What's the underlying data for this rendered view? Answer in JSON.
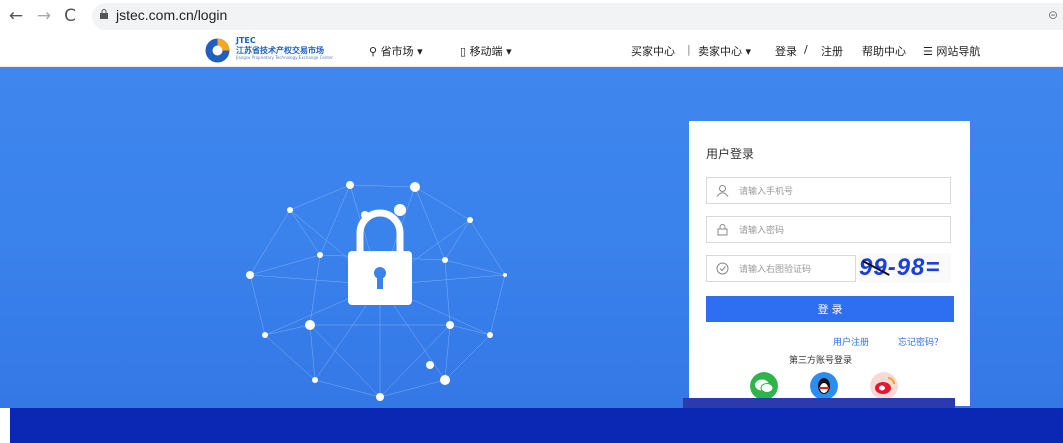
{
  "browser": {
    "back_icon": "arrow-left-icon",
    "forward_icon": "arrow-right-icon",
    "reload_icon": "reload-icon",
    "url": "jstec.com.cn/login"
  },
  "header": {
    "brand_short": "JTEC",
    "brand_name": "江苏省技术产权交易市场",
    "brand_en": "Jiangsu Proprietary Technology Exchange Center",
    "location": "省市场",
    "mobile": "移动端",
    "buyer": "买家中心",
    "separator": "|",
    "seller": "卖家中心",
    "login": "登录",
    "slash": "/",
    "register": "注册",
    "help": "帮助中心",
    "sitemap": "网站导航"
  },
  "login": {
    "title": "用户登录",
    "phone_placeholder": "请输入手机号",
    "password_placeholder": "请输入密码",
    "captcha_placeholder": "请输入右图验证码",
    "captcha_text": "99-98=",
    "submit": "登 录",
    "register_link": "用户注册",
    "forgot_link": "忘记密码？",
    "third_party": "第三方账号登录"
  },
  "colors": {
    "hero": "#3a82ec",
    "primary": "#2e6ff2",
    "bottom_bar": "#0a28b4"
  }
}
